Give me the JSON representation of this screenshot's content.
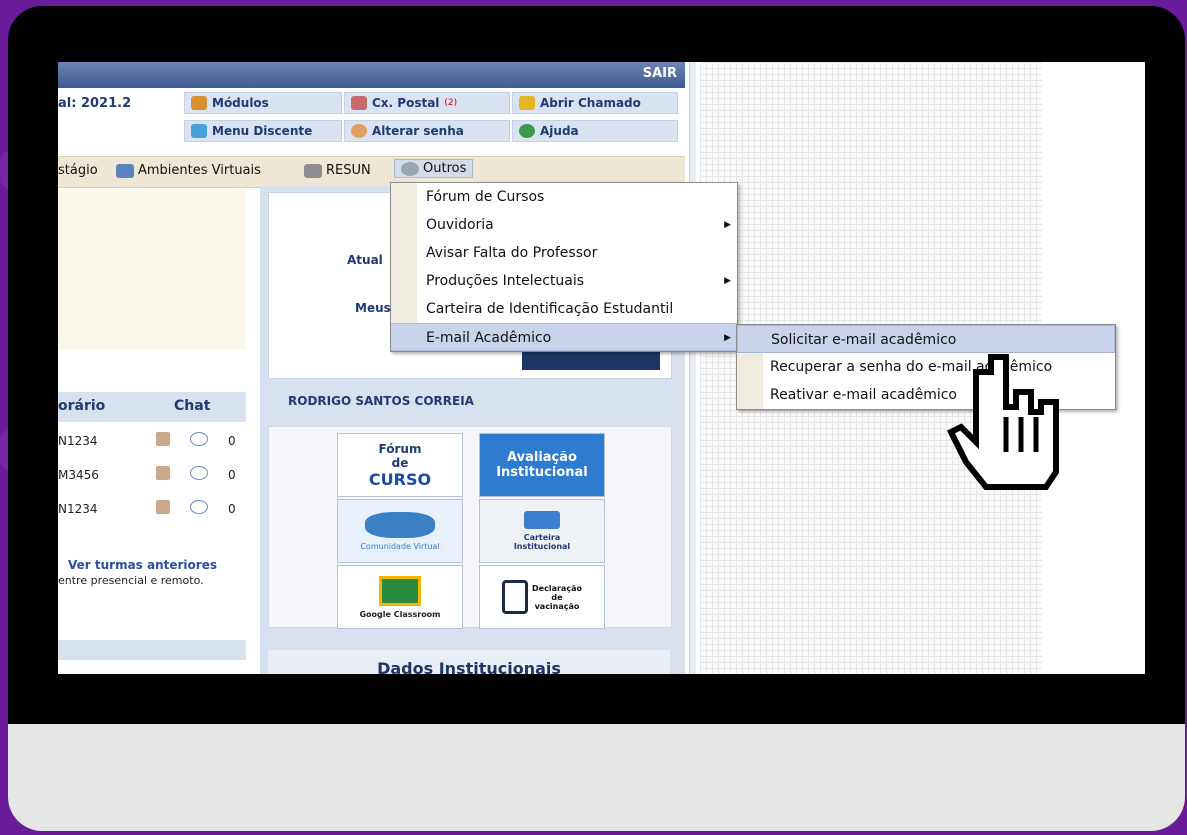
{
  "header": {
    "exit_label": "SAIR",
    "semester_label": "al: 2021.2"
  },
  "toolbar": {
    "modulos": "Módulos",
    "caixa_postal": "Cx. Postal",
    "caixa_postal_count": "(2)",
    "abrir_chamado": "Abrir Chamado",
    "menu_discente": "Menu Discente",
    "alterar_senha": "Alterar senha",
    "ajuda": "Ajuda"
  },
  "menubar": {
    "estagio": "stágio",
    "ambientes_virtuais": "Ambientes Virtuais",
    "resun": "RESUN",
    "outros": "Outros"
  },
  "dropdown": {
    "items": [
      {
        "label": "Fórum de Cursos",
        "has_submenu": false
      },
      {
        "label": "Ouvidoria",
        "has_submenu": true
      },
      {
        "label": "Avisar Falta do Professor",
        "has_submenu": false
      },
      {
        "label": "Produções Intelectuais",
        "has_submenu": true
      },
      {
        "label": "Carteira de Identificação Estudantil",
        "has_submenu": false
      },
      {
        "label": "E-mail Acadêmico",
        "has_submenu": true
      }
    ],
    "arrow": "▶"
  },
  "submenu": {
    "items": [
      "Solicitar e-mail acadêmico",
      "Recuperar a senha do e-mail acadêmico",
      "Reativar e-mail acadêmico"
    ]
  },
  "profile": {
    "atual_label": "Atual",
    "meus_label": "Meus",
    "student_name": "RODRIGO SANTOS CORREIA"
  },
  "turmas": {
    "col_horario": "orário",
    "col_chat": "Chat",
    "rows": [
      {
        "code": "N1234",
        "count": "0"
      },
      {
        "code": "M3456",
        "count": "0"
      },
      {
        "code": "N1234",
        "count": "0"
      }
    ],
    "ver_turmas": "Ver turmas anteriores",
    "entre_text": "entre presencial e remoto."
  },
  "portals": {
    "forum_line1": "Fórum",
    "forum_line2": "de",
    "forum_line3": "CURSO",
    "avaliacao_line1": "Avaliação",
    "avaliacao_line2": "Institucional",
    "comunidade": "Comunidade Virtual",
    "carteira_line1": "Carteira",
    "carteira_line2": "Institucional",
    "classroom": "Google Classroom",
    "declaracao_line1": "Declaração",
    "declaracao_line2": "de",
    "declaracao_line3": "vacinação"
  },
  "dados_institucionais": "Dados Institucionais"
}
